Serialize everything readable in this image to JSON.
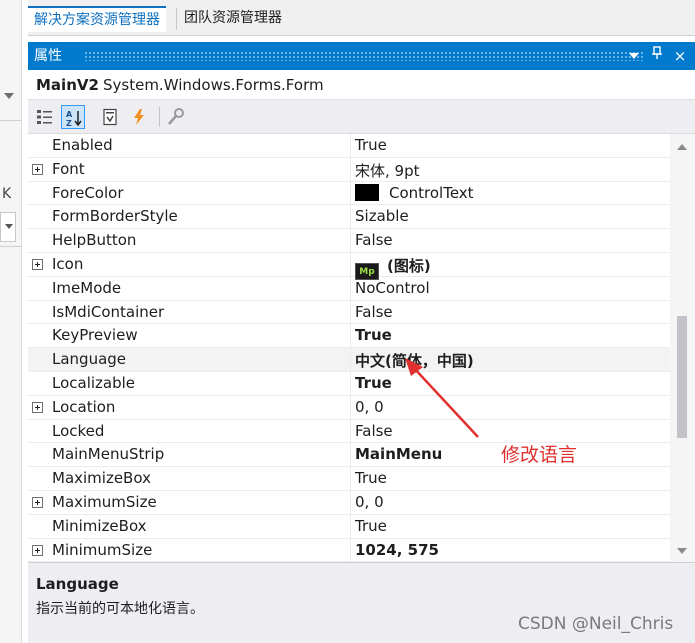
{
  "tabs": [
    {
      "label": "解决方案资源管理器",
      "active": true
    },
    {
      "label": "团队资源管理器",
      "active": false
    }
  ],
  "left_strip": {
    "label": "K"
  },
  "panel": {
    "title": "属性",
    "buttons": [
      "menu-down",
      "pin",
      "close"
    ],
    "close_glyph": "×",
    "pin_glyph": "ᵖ"
  },
  "object": {
    "name": "MainV2",
    "type": "System.Windows.Forms.Form"
  },
  "toolbar_icons": [
    "categorized-icon",
    "alphabetical-icon",
    "properties-icon",
    "events-icon",
    "property-pages-icon"
  ],
  "properties": [
    {
      "name": "Enabled",
      "value": "True",
      "expandable": false,
      "bold": false
    },
    {
      "name": "Font",
      "value": "宋体, 9pt",
      "expandable": true,
      "bold": false
    },
    {
      "name": "ForeColor",
      "value": "ControlText",
      "expandable": false,
      "bold": false,
      "swatch": "#000000"
    },
    {
      "name": "FormBorderStyle",
      "value": "Sizable",
      "expandable": false,
      "bold": false
    },
    {
      "name": "HelpButton",
      "value": "False",
      "expandable": false,
      "bold": false
    },
    {
      "name": "Icon",
      "value": "(图标)",
      "expandable": true,
      "bold": true,
      "icon_thumb": "Mp"
    },
    {
      "name": "ImeMode",
      "value": "NoControl",
      "expandable": false,
      "bold": false
    },
    {
      "name": "IsMdiContainer",
      "value": "False",
      "expandable": false,
      "bold": false
    },
    {
      "name": "KeyPreview",
      "value": "True",
      "expandable": false,
      "bold": true
    },
    {
      "name": "Language",
      "value": "中文(简体，中国)",
      "expandable": false,
      "bold": true,
      "highlighted": true
    },
    {
      "name": "Localizable",
      "value": "True",
      "expandable": false,
      "bold": true
    },
    {
      "name": "Location",
      "value": "0, 0",
      "expandable": true,
      "bold": false
    },
    {
      "name": "Locked",
      "value": "False",
      "expandable": false,
      "bold": false
    },
    {
      "name": "MainMenuStrip",
      "value": "MainMenu",
      "expandable": false,
      "bold": true
    },
    {
      "name": "MaximizeBox",
      "value": "True",
      "expandable": false,
      "bold": false
    },
    {
      "name": "MaximumSize",
      "value": "0, 0",
      "expandable": true,
      "bold": false
    },
    {
      "name": "MinimizeBox",
      "value": "True",
      "expandable": false,
      "bold": false
    },
    {
      "name": "MinimumSize",
      "value": "1024, 575",
      "expandable": true,
      "bold": true
    }
  ],
  "description": {
    "title": "Language",
    "text": "指示当前的可本地化语言。"
  },
  "annotation": {
    "text": "修改语言",
    "color": "#e03030"
  },
  "watermark": "CSDN @Neil_Chris",
  "colors": {
    "accent": "#007acc",
    "tab_active": "#0e70c0",
    "annotation": "#e03030"
  }
}
